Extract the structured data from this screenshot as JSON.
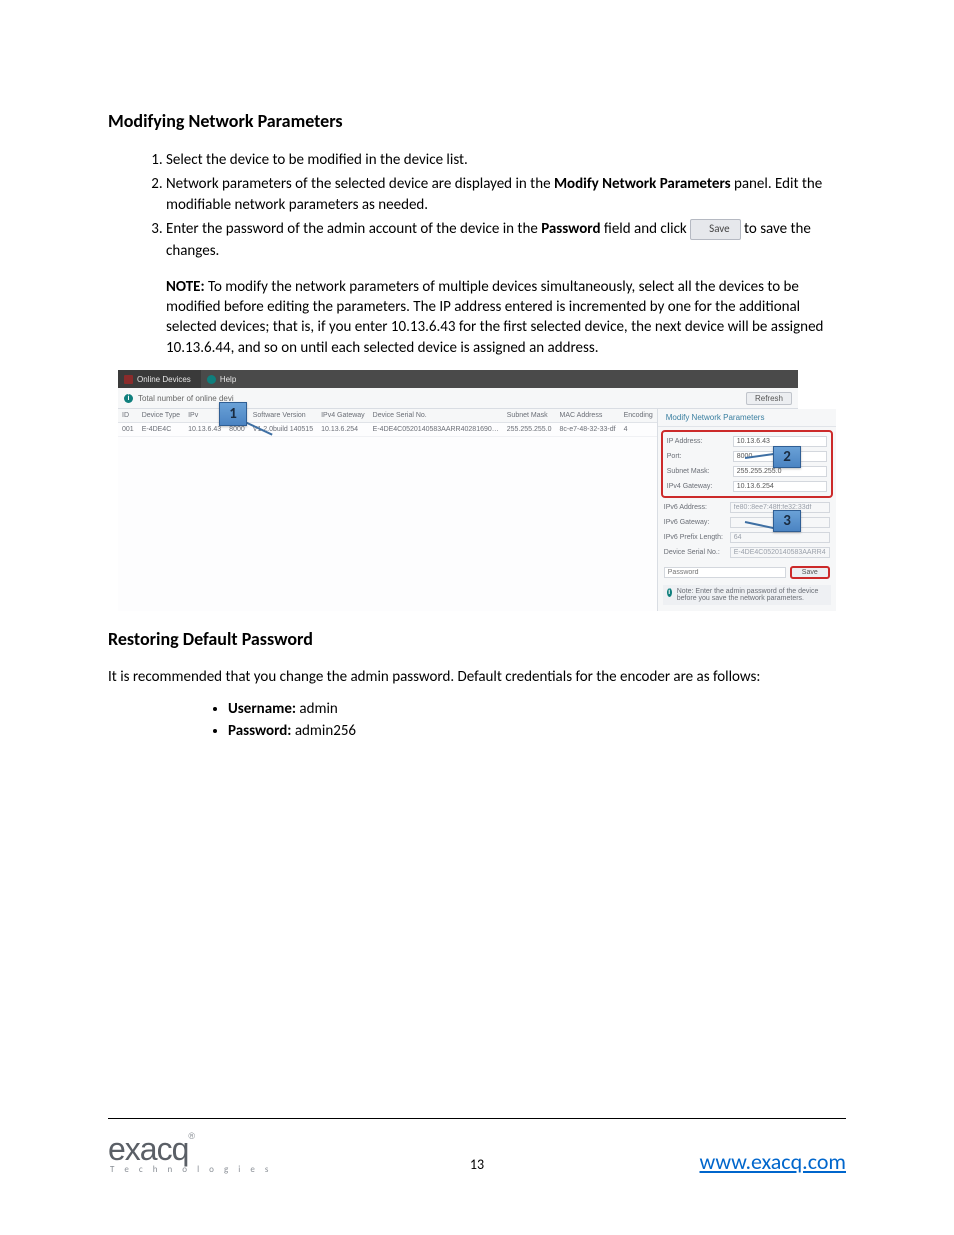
{
  "section1_title": "Modifying Network Parameters",
  "steps": [
    "Select the device to be modified in the device list.",
    "Network parameters of the selected device are displayed in the <b>Modify Network Parameters</b> panel. Edit the modifiable network parameters as needed.",
    "Enter the password of the admin account of the device in the <b>Password</b> field and click [SAVE] to save the changes."
  ],
  "save_btn_label": "Save",
  "note_label": "NOTE:",
  "note_text": " To modify the network parameters of multiple devices simultaneously, select all the devices to be modified before editing the parameters. The IP address entered is incremented by one for the additional selected devices; that is, if you enter 10.13.6.43 for the first selected device, the next device will be assigned 10.13.6.44, and so on until each selected device is assigned an address.",
  "toolbar": {
    "tab1": "Online Devices",
    "tab2": "Help"
  },
  "subbar": {
    "left": "Total number of online devi",
    "right": "Refresh"
  },
  "table": {
    "headers": [
      "ID",
      "Device Type",
      "IPv",
      "Port",
      "Software Version",
      "IPv4 Gateway",
      "Device Serial No.",
      "Subnet Mask",
      "MAC Address",
      "Encoding"
    ],
    "row": [
      "001",
      "E-4DE4C",
      "10.13.6.43",
      "8000",
      "V1.2.0build 140515",
      "10.13.6.254",
      "E-4DE4C0520140583AARR40281690…",
      "255.255.255.0",
      "8c-e7-48-32-33-df",
      "4"
    ]
  },
  "panel": {
    "title": "Modify Network Parameters",
    "ip_addr_lbl": "IP Address:",
    "ip_addr_val": "10.13.6.43",
    "port_lbl": "Port:",
    "port_val": "8000",
    "mask_lbl": "Subnet Mask:",
    "mask_val": "255.255.255.0",
    "gw_lbl": "IPv4 Gateway:",
    "gw_val": "10.13.6.254",
    "v6addr_lbl": "IPv6 Address:",
    "v6addr_val": "fe80::8ee7:48ff:fe32:33df",
    "v6gw_lbl": "IPv6 Gateway:",
    "v6gw_val": "",
    "v6len_lbl": "IPv6 Prefix Length:",
    "v6len_val": "64",
    "serial_lbl": "Device Serial No.:",
    "serial_val": "E-4DE4C0520140583AARR4",
    "pw_lbl": "Password",
    "save_lbl": "Save",
    "note": "Note: Enter the admin password of the device before you save the network parameters."
  },
  "callouts": {
    "c1": "1",
    "c2": "2",
    "c3": "3"
  },
  "section2_title": "Restoring Default Password",
  "section2_intro": "It is recommended that you change the admin password. Default credentials for the encoder are as follows:",
  "cred_user_lbl": "Username:",
  "cred_user_val": " admin",
  "cred_pw_lbl": "Password:",
  "cred_pw_val": " admin256",
  "footer": {
    "page": "13",
    "logo_main": "exacq",
    "logo_sub": "T e c h n o l o g i e s",
    "url": "www.exacq.com"
  }
}
